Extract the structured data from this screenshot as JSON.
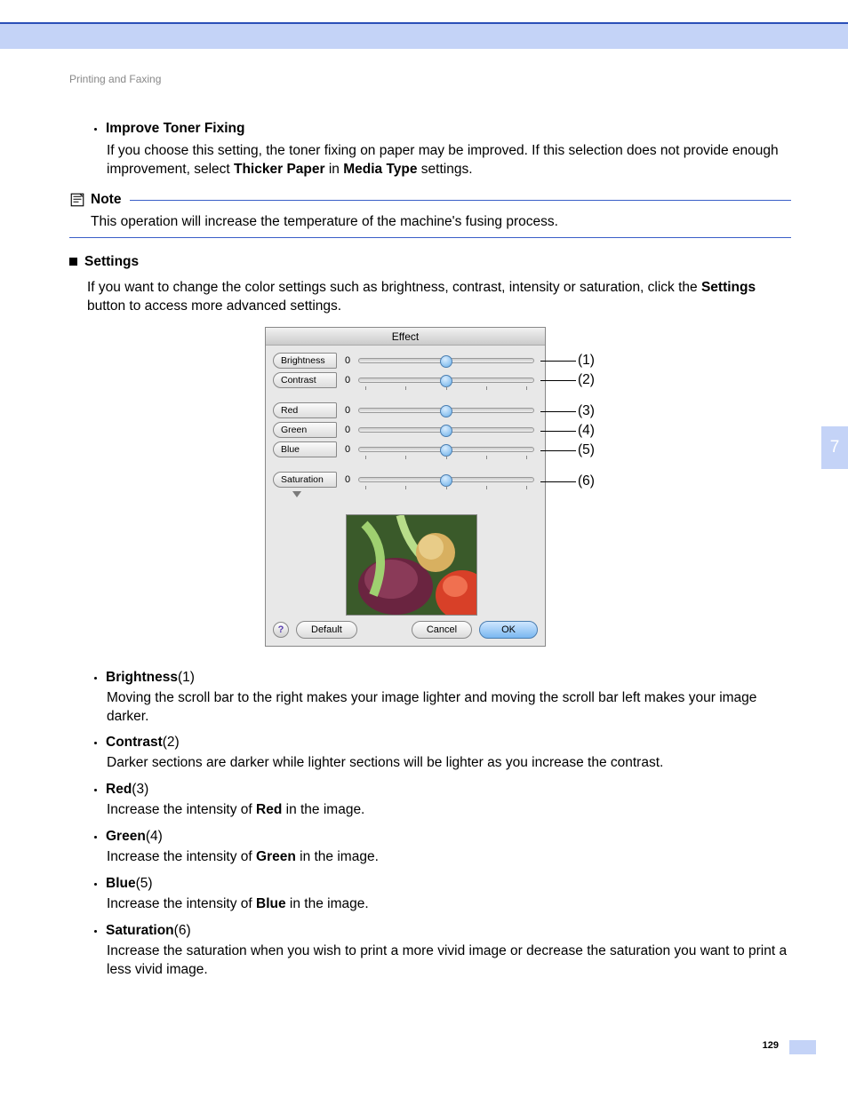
{
  "breadcrumb": "Printing and Faxing",
  "sideTab": "7",
  "pageNum": "129",
  "improve": {
    "title": "Improve Toner Fixing",
    "body_pre": "If you choose this setting, the toner fixing on paper may be improved. If this selection does not provide enough improvement, select ",
    "bold1": "Thicker Paper",
    "mid": " in ",
    "bold2": "Media Type",
    "tail": " settings."
  },
  "note": {
    "label": "Note",
    "text": "This operation will increase the temperature of the machine's fusing process."
  },
  "settings": {
    "title": "Settings",
    "body_pre": "If you want to change the color settings such as brightness, contrast, intensity or saturation, click  the ",
    "bold": "Settings",
    "tail": " button to access more advanced settings."
  },
  "panel": {
    "title": "Effect",
    "sliders": [
      {
        "label": "Brightness",
        "value": "0"
      },
      {
        "label": "Contrast",
        "value": "0"
      },
      {
        "label": "Red",
        "value": "0"
      },
      {
        "label": "Green",
        "value": "0"
      },
      {
        "label": "Blue",
        "value": "0"
      },
      {
        "label": "Saturation",
        "value": "0"
      }
    ],
    "help": "?",
    "default": "Default",
    "cancel": "Cancel",
    "ok": "OK"
  },
  "callouts": [
    "(1)",
    "(2)",
    "(3)",
    "(4)",
    "(5)",
    "(6)"
  ],
  "items": {
    "brightness": {
      "head": "Brightness",
      "num": " (1)",
      "body": "Moving the scroll bar to the right makes your image lighter and moving the scroll bar left makes your image darker."
    },
    "contrast": {
      "head": "Contrast",
      "num": " (2)",
      "body": "Darker sections are darker while lighter sections will be lighter as you increase the contrast."
    },
    "red": {
      "head": "Red",
      "num": " (3)",
      "pre": "Increase the intensity of ",
      "bold": "Red",
      "post": " in the image."
    },
    "green": {
      "head": "Green",
      "num": " (4)",
      "pre": "Increase the intensity of ",
      "bold": "Green",
      "post": " in the image."
    },
    "blue": {
      "head": "Blue",
      "num": " (5)",
      "pre": "Increase the intensity of ",
      "bold": "Blue",
      "post": " in the image."
    },
    "saturation": {
      "head": "Saturation",
      "num": " (6)",
      "body": "Increase the saturation when you wish to print a more vivid image or decrease the saturation you want to print a less vivid image."
    }
  }
}
